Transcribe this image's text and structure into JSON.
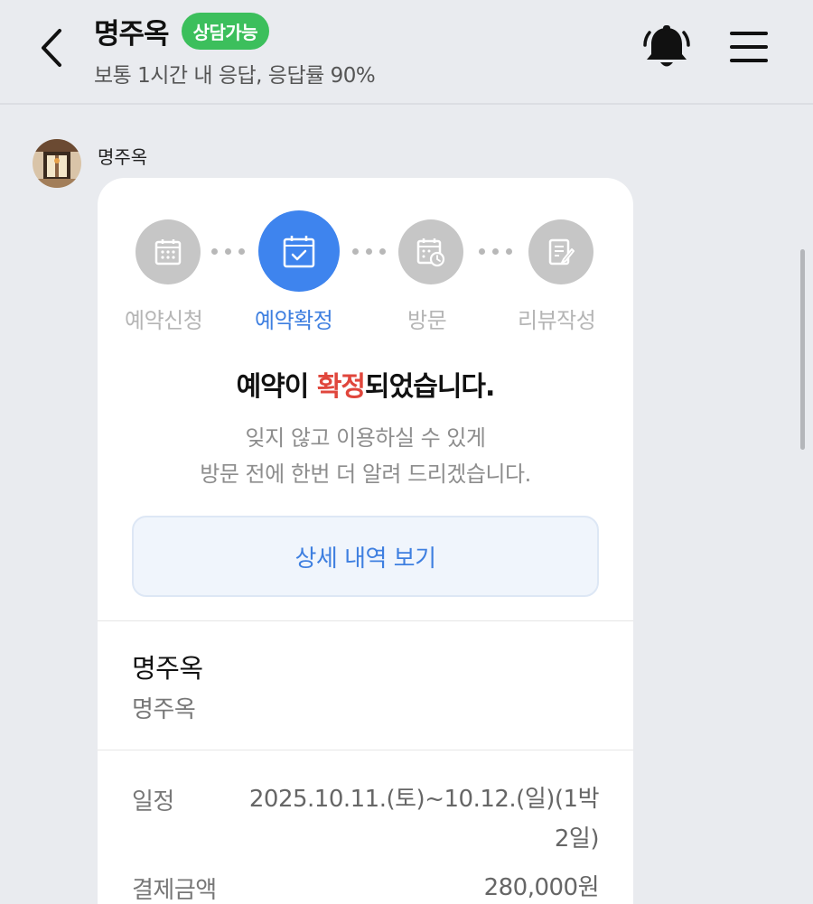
{
  "header": {
    "title": "명주옥",
    "status_badge": "상담가능",
    "subtitle": "보통 1시간 내 응답, 응답률 90%"
  },
  "message": {
    "sender_name": "명주옥"
  },
  "card": {
    "steps": [
      {
        "label": "예약신청",
        "state": "inactive",
        "icon": "calendar-icon"
      },
      {
        "label": "예약확정",
        "state": "active",
        "icon": "calendar-check-icon"
      },
      {
        "label": "방문",
        "state": "inactive",
        "icon": "calendar-clock-icon"
      },
      {
        "label": "리뷰작성",
        "state": "inactive",
        "icon": "edit-note-icon"
      }
    ],
    "headline_pre": "예약이 ",
    "headline_highlight": "확정",
    "headline_post": "되었습니다.",
    "desc_line1": "잊지 않고 이용하실 수 있게",
    "desc_line2": "방문 전에 한번 더 알려 드리겠습니다.",
    "detail_button": "상세 내역 보기",
    "place_name": "명주옥",
    "place_sub": "명주옥",
    "schedule_label": "일정",
    "schedule_value": "2025.10.11.(토)~10.12.(일)(1박 2일)",
    "payment_label": "결제금액",
    "payment_value": "280,000원"
  },
  "colors": {
    "accent_blue": "#3e84ee",
    "badge_green": "#3cbf5c",
    "highlight_red": "#e0463c"
  }
}
